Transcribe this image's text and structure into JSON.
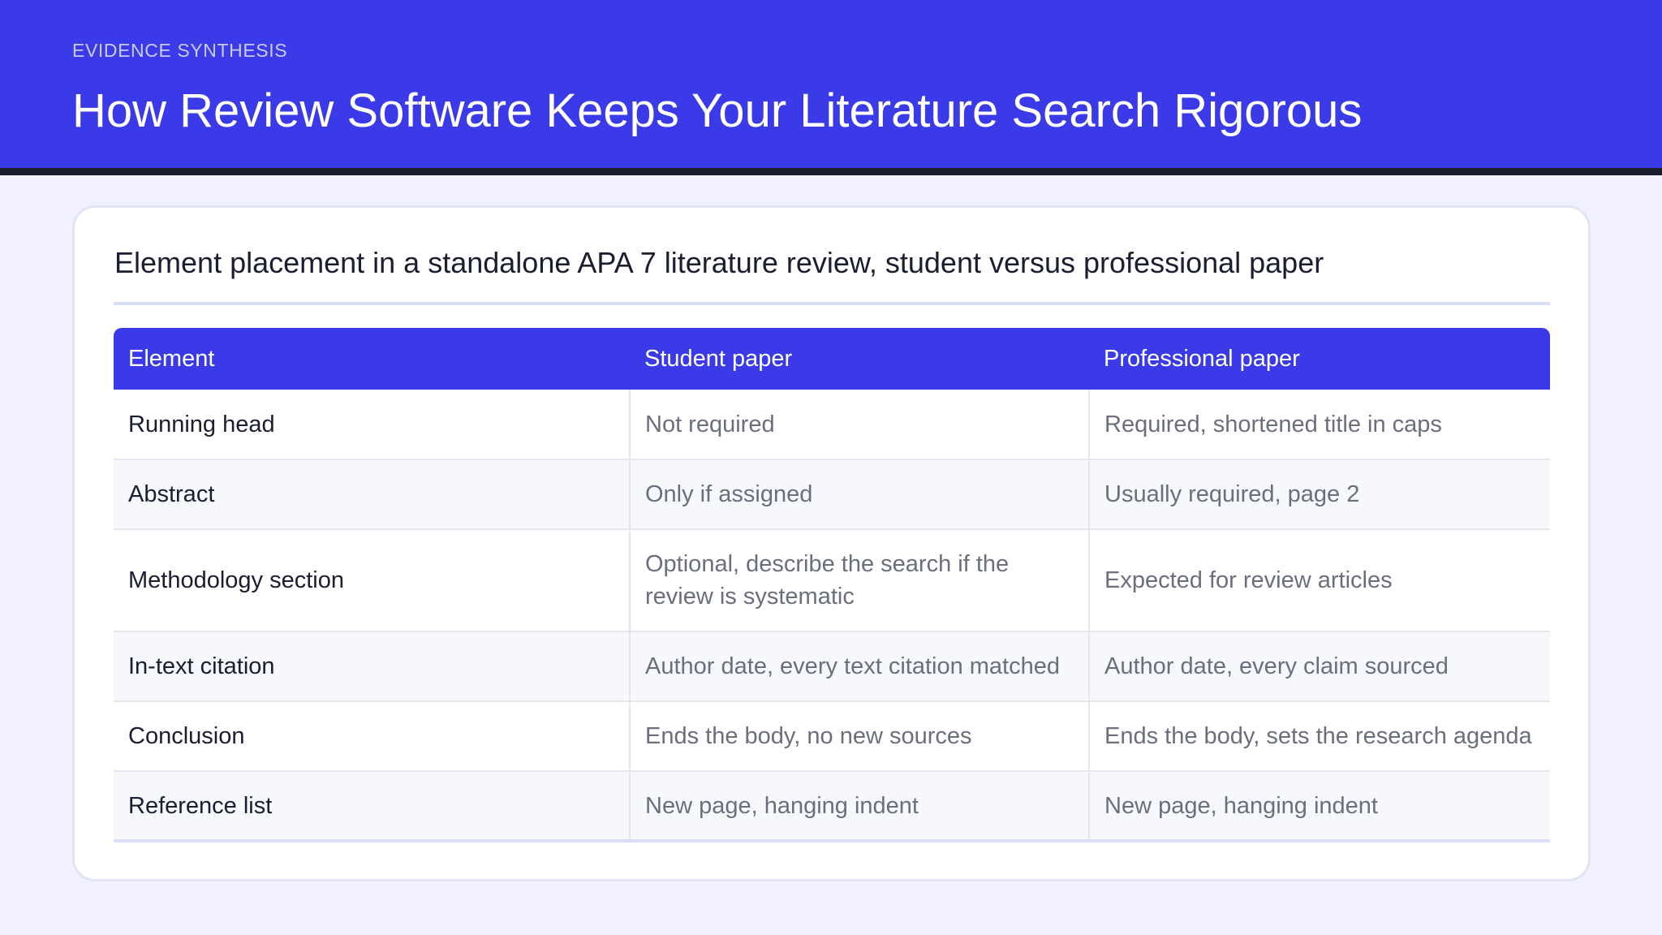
{
  "header": {
    "eyebrow": "EVIDENCE SYNTHESIS",
    "title": "How Review Software Keeps Your Literature Search Rigorous"
  },
  "card": {
    "caption": "Element placement in a standalone APA 7 literature review, student versus professional paper"
  },
  "table": {
    "columns": [
      "Element",
      "Student paper",
      "Professional paper"
    ],
    "rows": [
      {
        "element": "Running head",
        "student": "Not required",
        "professional": "Required, shortened title in caps"
      },
      {
        "element": "Abstract",
        "student": "Only if assigned",
        "professional": "Usually required, page 2"
      },
      {
        "element": "Methodology section",
        "student": "Optional, describe the search if the review is systematic",
        "professional": "Expected for review articles"
      },
      {
        "element": "In-text citation",
        "student": "Author date, every text citation matched",
        "professional": "Author date, every claim sourced"
      },
      {
        "element": "Conclusion",
        "student": "Ends the body, no new sources",
        "professional": "Ends the body, sets the research agenda"
      },
      {
        "element": "Reference list",
        "student": "New page, hanging indent",
        "professional": "New page, hanging indent"
      }
    ]
  },
  "colors": {
    "accent": "#3a3ae8",
    "header_rule": "#1c1d2e",
    "page_background": "#f0f1fd",
    "card_background": "#ffffff",
    "text_primary": "#1b1d30",
    "text_secondary": "#6b6f7d"
  }
}
